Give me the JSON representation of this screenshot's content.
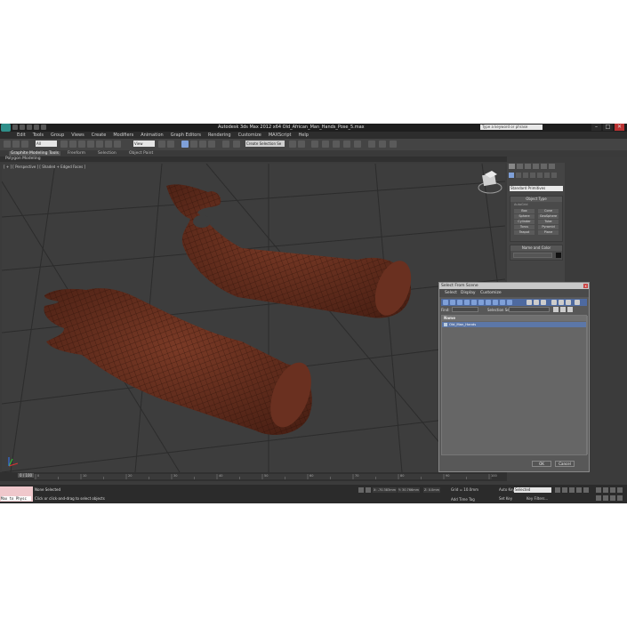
{
  "window": {
    "title": "Autodesk 3ds Max 2012 x64     Old_African_Man_Hands_Pose_5.max",
    "search_placeholder": "Type a keyword or phrase",
    "min": "–",
    "max": "□",
    "close": "✕"
  },
  "menu": {
    "items": [
      "Edit",
      "Tools",
      "Group",
      "Views",
      "Create",
      "Modifiers",
      "Animation",
      "Graph Editors",
      "Rendering",
      "Customize",
      "MAXScript",
      "Help"
    ]
  },
  "toolbar": {
    "filter_dropdown": "All",
    "view_dropdown": "View",
    "named_selection": "Create Selection Se"
  },
  "ribbon": {
    "tabs": [
      "Graphite Modeling Tools",
      "Freeform",
      "Selection",
      "Object Paint"
    ],
    "active_tab": "Graphite Modeling Tools",
    "sub_label": "Polygon Modeling"
  },
  "viewport": {
    "label": "[ + ] [ Perspective ] [ Shaded + Edged Faces ]"
  },
  "command_panel": {
    "primitive_dropdown": "Standard Primitives",
    "object_type_header": "Object Type",
    "autogrid_label": "AutoGrid",
    "object_types": [
      "Box",
      "Cone",
      "Sphere",
      "GeoSphere",
      "Cylinder",
      "Tube",
      "Torus",
      "Pyramid",
      "Teapot",
      "Plane"
    ],
    "name_color_header": "Name and Color"
  },
  "timeline": {
    "frame": "0 / 100",
    "ticks": [
      "0",
      "10",
      "20",
      "30",
      "40",
      "50",
      "60",
      "70",
      "80",
      "90",
      "100"
    ]
  },
  "status": {
    "maxscript_text": "Max to Physc",
    "selection_text": "None Selected",
    "hint_text": "Click or click-and-drag to select objects",
    "x_label": "X:",
    "x_value": "-70.383mm",
    "y_label": "Y:",
    "y_value": "30.766mm",
    "z_label": "Z:",
    "z_value": "0.0mm",
    "grid_text": "Grid = 10.0mm",
    "add_time_tag": "Add Time Tag",
    "auto_key": "Auto Key",
    "selected_dropdown": "Selected",
    "set_key": "Set Key",
    "key_filters": "Key Filters..."
  },
  "dialog": {
    "title": "Select From Scene",
    "menu": [
      "Select",
      "Display",
      "Customize"
    ],
    "find_label": "Find:",
    "selection_set_label": "Selection Set:",
    "column_header": "Name",
    "rows": [
      "Old_Man_Hands"
    ],
    "ok_label": "OK",
    "cancel_label": "Cancel",
    "close_icon": "x"
  },
  "colors": {
    "viewport_bg": "#3d3d3d",
    "hand_skin": "#5a2a1c",
    "selection_blue": "#5c77a8",
    "title_bar": "#1e1e1e"
  }
}
